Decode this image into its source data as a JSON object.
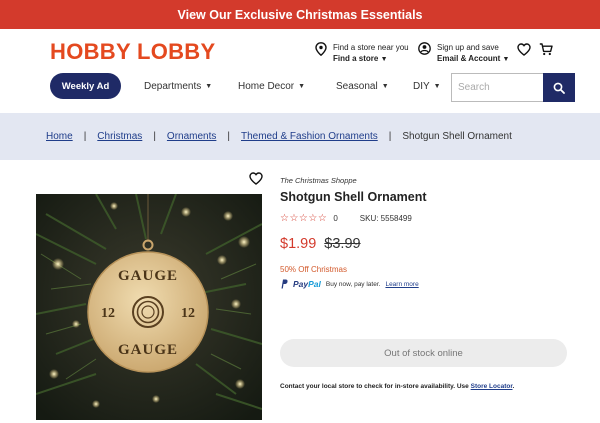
{
  "banner": {
    "text": "View Our Exclusive Christmas Essentials"
  },
  "header": {
    "logo": "HOBBY LOBBY",
    "store": {
      "line1": "Find a store near you",
      "line2": "Find a store"
    },
    "account": {
      "line1": "Sign up and save",
      "line2": "Email & Account"
    },
    "icons": [
      "location-pin-icon",
      "account-icon",
      "heart-icon",
      "cart-icon",
      "search-icon"
    ]
  },
  "nav": {
    "weekly_ad": "Weekly Ad",
    "items": [
      "Departments",
      "Home Decor",
      "Seasonal",
      "DIY"
    ],
    "search_placeholder": "Search"
  },
  "breadcrumbs": {
    "links": [
      "Home",
      "Christmas",
      "Ornaments",
      "Themed & Fashion Ornaments"
    ],
    "current": "Shotgun Shell Ornament"
  },
  "image": {
    "ornament_top": "GAUGE",
    "ornament_left": "12",
    "ornament_right": "12",
    "ornament_bottom": "GAUGE"
  },
  "product": {
    "brand": "The Christmas Shoppe",
    "title": "Shotgun Shell Ornament",
    "rating_stars": "☆☆☆☆☆",
    "rating_value": 0,
    "review_count": "0",
    "sku": "SKU: 5558499",
    "price": "$1.99",
    "was_price": "$3.99",
    "promo": "50% Off Christmas",
    "paypal": {
      "logo_a": "Pay",
      "logo_b": "Pal",
      "text": "Buy now, pay later.",
      "link": "Learn more"
    },
    "stock_button": "Out of stock online",
    "contact_text": "Contact your local store to check for in-store availability. Use ",
    "contact_link": "Store Locator",
    "contact_end": "."
  },
  "colors": {
    "banner": "#d33a2c",
    "logo": "#e4491f",
    "navy": "#1f2a66",
    "price": "#d33a2c",
    "crumb_bg": "#e3e7f2"
  }
}
